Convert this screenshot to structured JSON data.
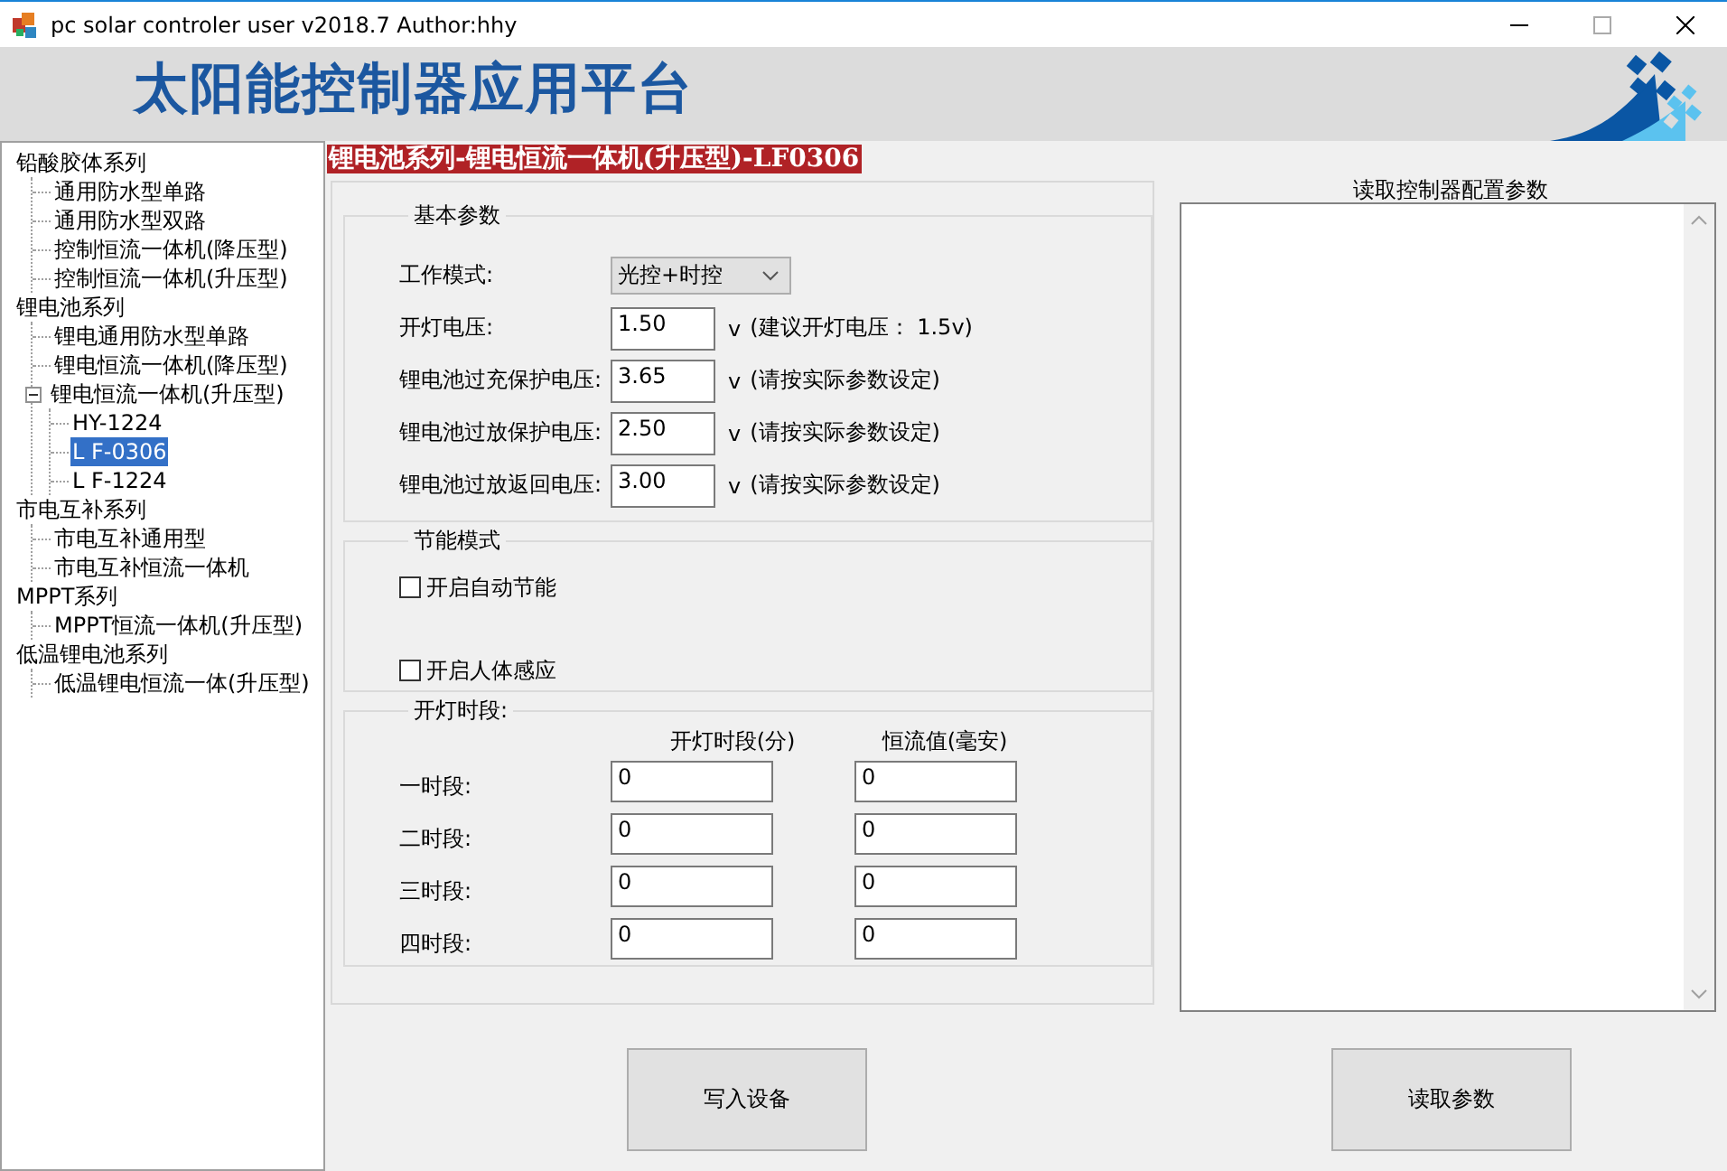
{
  "window": {
    "title": "pc solar controler user v2018.7 Author:hhy"
  },
  "header": {
    "title": "太阳能控制器应用平台"
  },
  "tree": [
    {
      "label": "铅酸胶体系列",
      "selected": false,
      "children": [
        {
          "label": "通用防水型单路",
          "selected": false
        },
        {
          "label": "通用防水型双路",
          "selected": false
        },
        {
          "label": "控制恒流一体机(降压型)",
          "selected": false
        },
        {
          "label": "控制恒流一体机(升压型)",
          "selected": false
        }
      ]
    },
    {
      "label": "锂电池系列",
      "selected": false,
      "children": [
        {
          "label": "锂电通用防水型单路",
          "selected": false
        },
        {
          "label": "锂电恒流一体机(降压型)",
          "selected": false
        },
        {
          "label": "锂电恒流一体机(升压型)",
          "selected": false,
          "expanded": true,
          "children": [
            {
              "label": "HY-1224",
              "selected": false
            },
            {
              "label": "L F-0306",
              "selected": true
            },
            {
              "label": "L F-1224",
              "selected": false
            }
          ]
        }
      ]
    },
    {
      "label": "市电互补系列",
      "selected": false,
      "children": [
        {
          "label": "市电互补通用型",
          "selected": false
        },
        {
          "label": "市电互补恒流一体机",
          "selected": false
        }
      ]
    },
    {
      "label": "MPPT系列",
      "selected": false,
      "children": [
        {
          "label": "MPPT恒流一体机(升压型)",
          "selected": false
        }
      ]
    },
    {
      "label": "低温锂电池系列",
      "selected": false,
      "children": [
        {
          "label": "低温锂电恒流一体(升压型)",
          "selected": false
        }
      ]
    }
  ],
  "device_heading": "锂电池系列-锂电恒流一体机(升压型)-LF0306",
  "basic": {
    "title": "基本参数",
    "fields": [
      {
        "kind": "select",
        "label": "工作模式:",
        "value": "光控+时控"
      },
      {
        "kind": "input",
        "label": "开灯电压:",
        "value": "1.50",
        "unit": "v",
        "note": "(建议开灯电压： 1.5v)"
      },
      {
        "kind": "input",
        "label": "锂电池过充保护电压:",
        "value": "3.65",
        "unit": "v",
        "note": "(请按实际参数设定)"
      },
      {
        "kind": "input",
        "label": "锂电池过放保护电压:",
        "value": "2.50",
        "unit": "v",
        "note": "(请按实际参数设定)"
      },
      {
        "kind": "input",
        "label": "锂电池过放返回电压:",
        "value": "3.00",
        "unit": "v",
        "note": "(请按实际参数设定)"
      }
    ]
  },
  "energy": {
    "title": "节能模式",
    "options": [
      {
        "label": "开启自动节能",
        "checked": false
      },
      {
        "label": "开启人体感应",
        "checked": false
      }
    ]
  },
  "schedule": {
    "title": "开灯时段:",
    "columns": [
      "开灯时段(分)",
      "恒流值(毫安)"
    ],
    "rows": [
      {
        "label": "一时段:",
        "values": [
          "0",
          "0"
        ]
      },
      {
        "label": "二时段:",
        "values": [
          "0",
          "0"
        ]
      },
      {
        "label": "三时段:",
        "values": [
          "0",
          "0"
        ]
      },
      {
        "label": "四时段:",
        "values": [
          "0",
          "0"
        ]
      }
    ]
  },
  "output": {
    "title": "读取控制器配置参数"
  },
  "buttons": [
    "写入设备",
    "读取参数"
  ]
}
